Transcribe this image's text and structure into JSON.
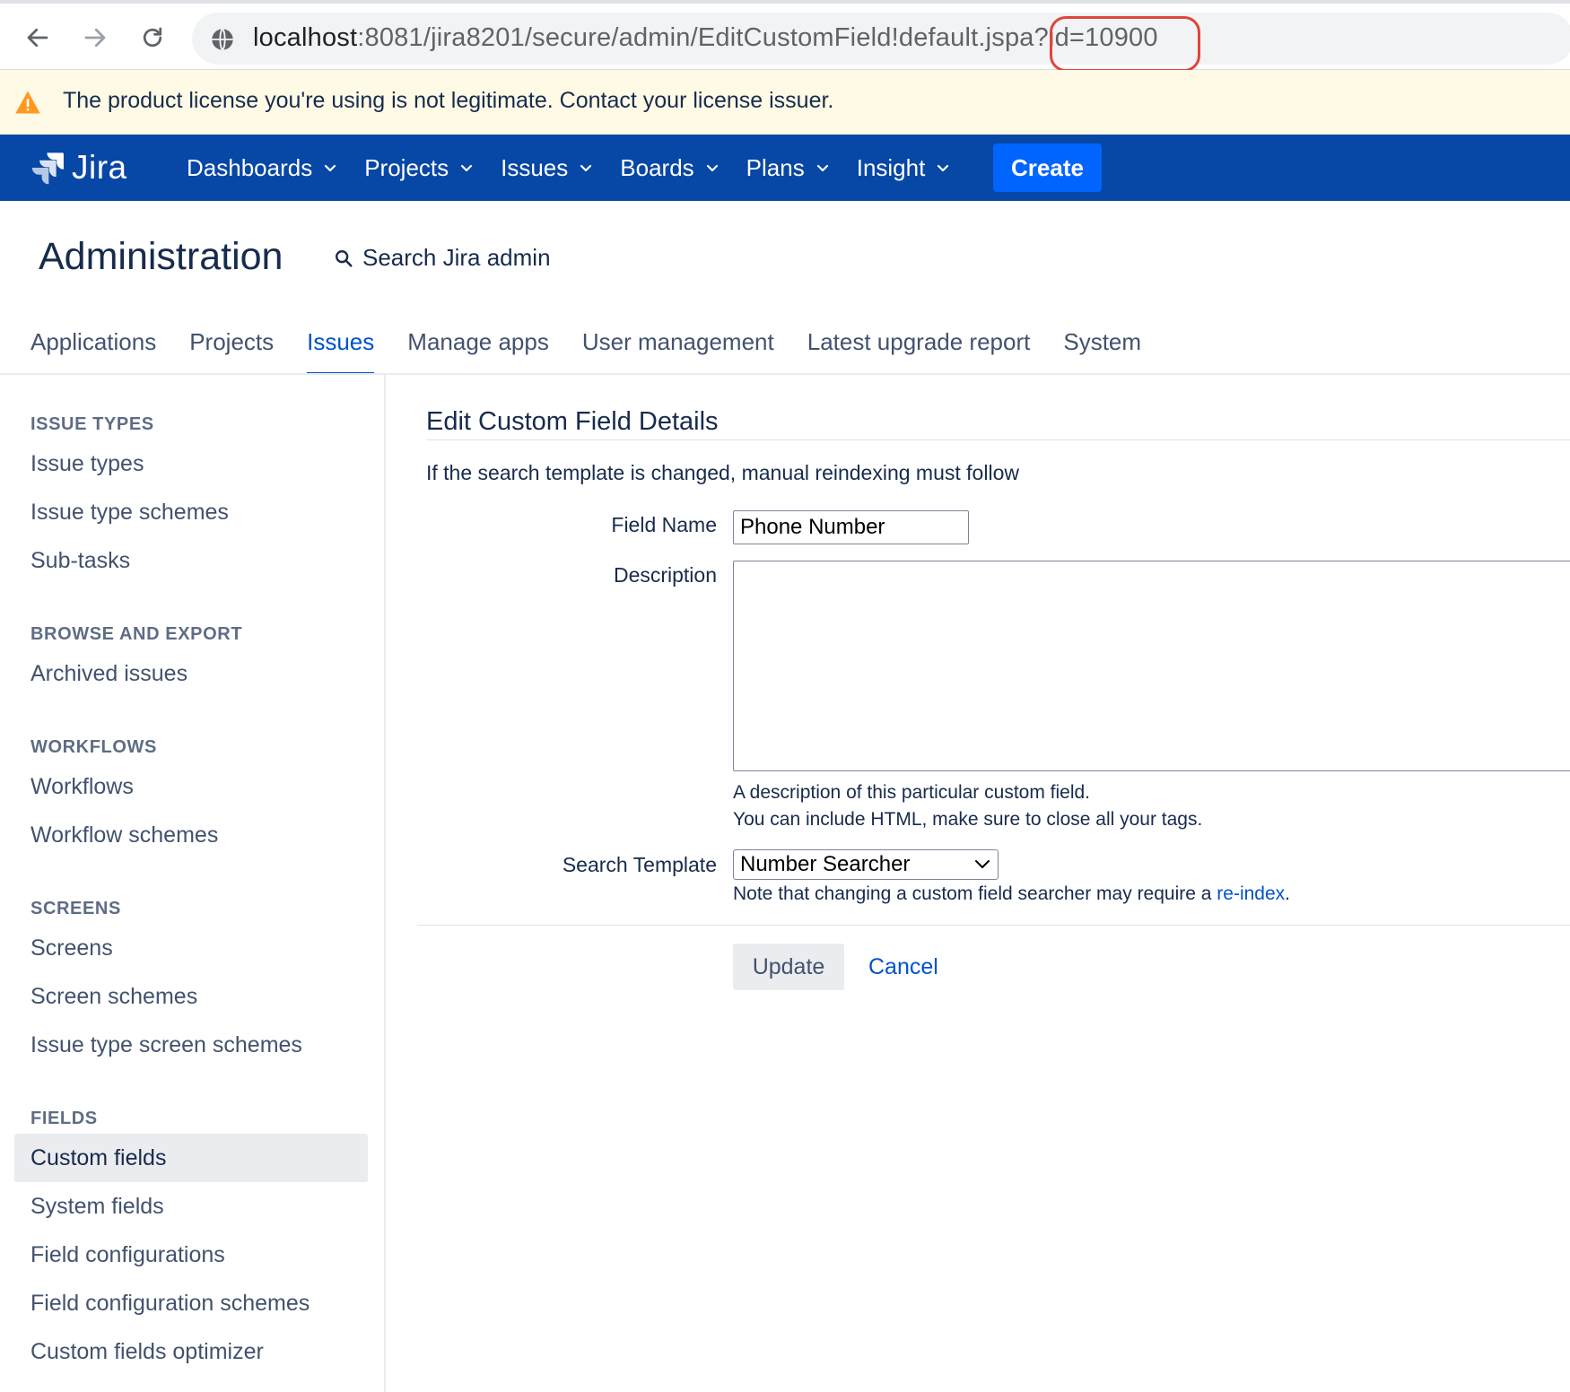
{
  "browser": {
    "url_host": "localhost",
    "url_path": ":8081/jira8201/secure/admin/EditCustomField!default.jspa?id=10900"
  },
  "license_banner": {
    "text": "The product license you're using is not legitimate. Contact your license issuer."
  },
  "header": {
    "logo_text": "Jira",
    "menu": [
      {
        "label": "Dashboards"
      },
      {
        "label": "Projects"
      },
      {
        "label": "Issues"
      },
      {
        "label": "Boards"
      },
      {
        "label": "Plans"
      },
      {
        "label": "Insight"
      }
    ],
    "create_label": "Create",
    "colors": {
      "bar": "#0747a6",
      "create": "#0065ff"
    }
  },
  "admin": {
    "title": "Administration",
    "search_label": "Search Jira admin",
    "tabs": [
      {
        "label": "Applications"
      },
      {
        "label": "Projects"
      },
      {
        "label": "Issues",
        "active": true
      },
      {
        "label": "Manage apps"
      },
      {
        "label": "User management"
      },
      {
        "label": "Latest upgrade report"
      },
      {
        "label": "System"
      }
    ]
  },
  "sidebar": {
    "sections": [
      {
        "heading": "ISSUE TYPES",
        "items": [
          "Issue types",
          "Issue type schemes",
          "Sub-tasks"
        ]
      },
      {
        "heading": "BROWSE AND EXPORT",
        "items": [
          "Archived issues"
        ]
      },
      {
        "heading": "WORKFLOWS",
        "items": [
          "Workflows",
          "Workflow schemes"
        ]
      },
      {
        "heading": "SCREENS",
        "items": [
          "Screens",
          "Screen schemes",
          "Issue type screen schemes"
        ]
      },
      {
        "heading": "FIELDS",
        "items": [
          "Custom fields",
          "System fields",
          "Field configurations",
          "Field configuration schemes",
          "Custom fields optimizer"
        ]
      }
    ],
    "active_item": "Custom fields"
  },
  "form": {
    "title": "Edit Custom Field Details",
    "info": "If the search template is changed, manual reindexing must follow",
    "field_name_label": "Field Name",
    "field_name_value": "Phone Number",
    "description_label": "Description",
    "description_value": "",
    "description_help_1": "A description of this particular custom field.",
    "description_help_2": "You can include HTML, make sure to close all your tags.",
    "search_template_label": "Search Template",
    "search_template_value": "Number Searcher",
    "note_prefix": "Note that changing a custom field searcher may require a ",
    "note_link": "re-index",
    "note_suffix": ".",
    "update_label": "Update",
    "cancel_label": "Cancel"
  }
}
